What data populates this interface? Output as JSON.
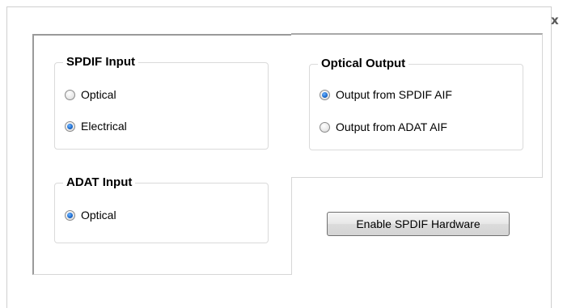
{
  "dialog": {
    "close_label": "x"
  },
  "spdif_input": {
    "title": "SPDIF Input",
    "options": [
      {
        "label": "Optical",
        "checked": false
      },
      {
        "label": "Electrical",
        "checked": true
      }
    ]
  },
  "adat_input": {
    "title": "ADAT Input",
    "options": [
      {
        "label": "Optical",
        "checked": true
      }
    ]
  },
  "optical_output": {
    "title": "Optical Output",
    "options": [
      {
        "label": "Output from SPDIF AIF",
        "checked": true
      },
      {
        "label": "Output from ADAT AIF",
        "checked": false
      }
    ]
  },
  "enable_button": {
    "label": "Enable SPDIF Hardware"
  },
  "colors": {
    "radio_selected": "#1f6fd1",
    "frame_border": "#9a9a9a"
  }
}
